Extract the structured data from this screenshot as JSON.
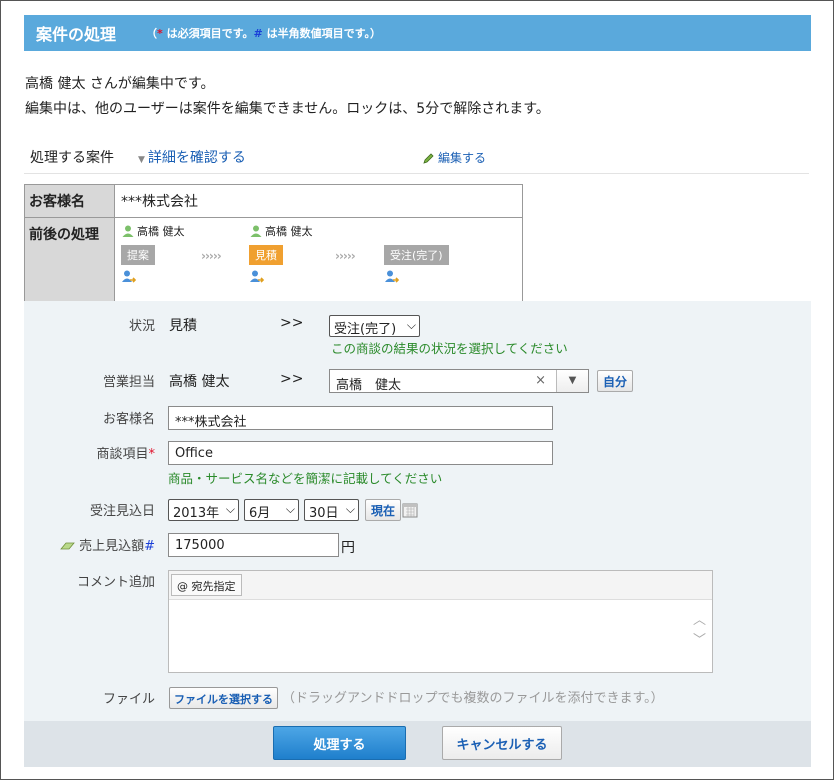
{
  "header": {
    "title": "案件の処理",
    "note_open": "（",
    "note_star": "*",
    "note_mid": " は必須項目です。",
    "note_hash": "#",
    "note_end": " は半角数値項目です。）"
  },
  "lock": {
    "line1": "高橋 健太 さんが編集中です。",
    "line2": "編集中は、他のユーザーは案件を編集できません。ロックは、5分で解除されます。"
  },
  "case": {
    "label": "処理する案件",
    "detail_link": "詳細を確認する",
    "edit_link": "編集する"
  },
  "info": {
    "customer_label": "お客様名",
    "customer_value": "***株式会社",
    "flow_label": "前後の処理",
    "stages": [
      {
        "user": "高橋 健太",
        "name": "提案",
        "active": false
      },
      {
        "user": "高橋 健太",
        "name": "見積",
        "active": true
      },
      {
        "user": "",
        "name": "受注(完了)",
        "active": false
      }
    ],
    "chevrons": "›››››"
  },
  "form": {
    "status": {
      "label": "状況",
      "current": "見積",
      "arrow": ">>",
      "selected": "受注(完了)",
      "hint": "この商談の結果の状況を選択してください"
    },
    "sales": {
      "label": "営業担当",
      "current": "高橋 健太",
      "arrow": ">>",
      "value": "高橋　健太",
      "self_button": "自分"
    },
    "customer": {
      "label": "お客様名",
      "value": "***株式会社"
    },
    "item": {
      "label": "商談項目",
      "req": "*",
      "value": "Office",
      "hint": "商品・サービス名などを簡潔に記載してください"
    },
    "date": {
      "label": "受注見込日",
      "year": "2013年",
      "month": "6月",
      "day": "30日",
      "now_button": "現在"
    },
    "amount": {
      "label": "売上見込額",
      "num": "#",
      "value": "175000",
      "unit": "円"
    },
    "comment": {
      "label": "コメント追加",
      "mention": "@ 宛先指定"
    },
    "file": {
      "label": "ファイル",
      "button": "ファイルを選択する",
      "hint": "（ドラッグアンドドロップでも複数のファイルを添付できます。）"
    }
  },
  "footer": {
    "submit": "処理する",
    "cancel": "キャンセルする"
  }
}
